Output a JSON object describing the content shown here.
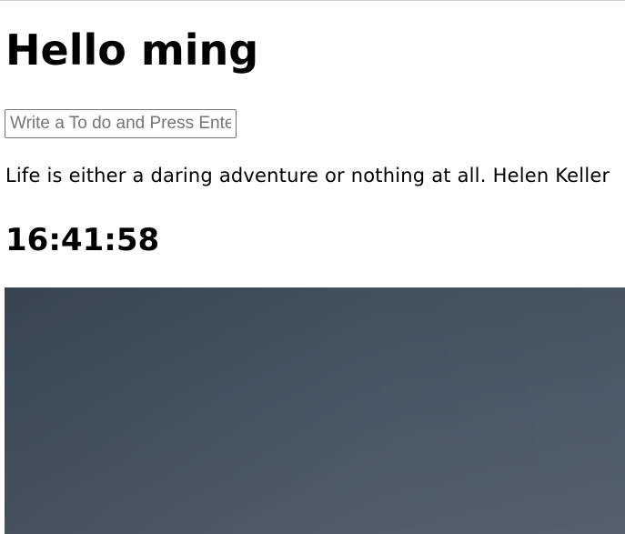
{
  "greeting": {
    "text": "Hello ming"
  },
  "todo": {
    "input_value": "",
    "placeholder": "Write a To do and Press Enter"
  },
  "quote": {
    "text": "Life is either a daring adventure or nothing at all.",
    "author": "Helen Keller"
  },
  "clock": {
    "time": "16:41:58"
  },
  "background": {
    "description_color": "#425260"
  }
}
